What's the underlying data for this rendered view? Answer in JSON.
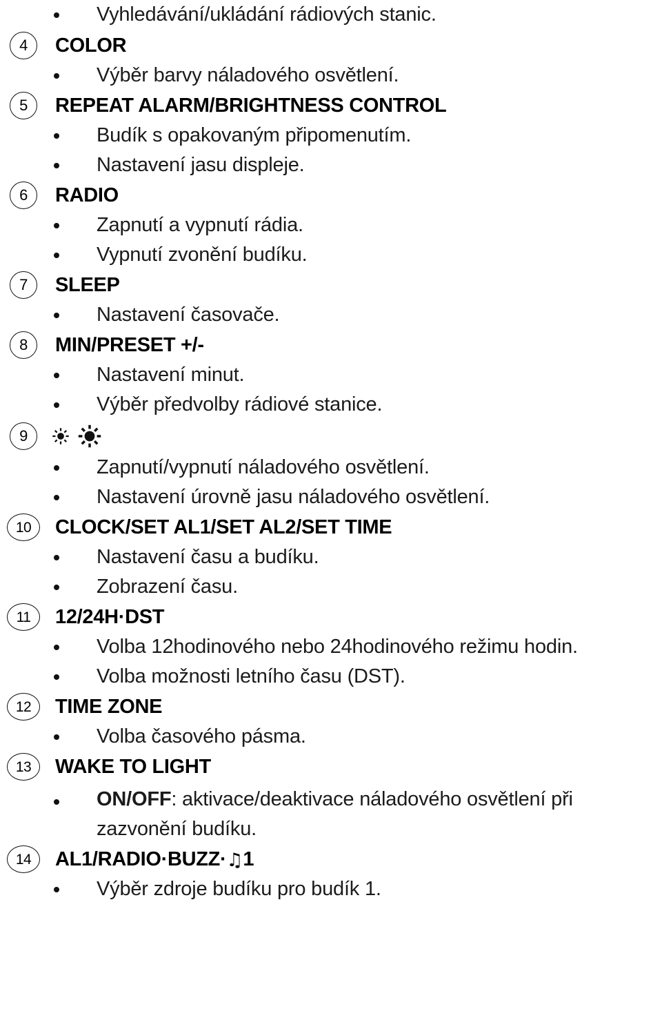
{
  "page": {
    "language": "cs",
    "text_color": "#111111"
  },
  "intro_bullet": "Vyhledávání/ukládání rádiových stanic.",
  "items": [
    {
      "number": "4",
      "heading": "COLOR",
      "bullets": [
        "Výběr barvy náladového osvětlení."
      ]
    },
    {
      "number": "5",
      "heading": "REPEAT ALARM/BRIGHTNESS CONTROL",
      "bullets": [
        "Budík s opakovaným připomenutím.",
        "Nastavení jasu displeje."
      ]
    },
    {
      "number": "6",
      "heading": "RADIO",
      "bullets": [
        "Zapnutí a vypnutí rádia.",
        "Vypnutí zvonění budíku."
      ]
    },
    {
      "number": "7",
      "heading": "SLEEP",
      "bullets": [
        "Nastavení časovače."
      ]
    },
    {
      "number": "8",
      "heading": "MIN/PRESET +/-",
      "bullets": [
        "Nastavení minut.",
        "Výběr předvolby rádiové stanice."
      ]
    },
    {
      "number": "9",
      "heading": "",
      "heading_icons": [
        "sun-dim-icon",
        "sun-bright-icon"
      ],
      "bullets": [
        "Zapnutí/vypnutí náladového osvětlení.",
        "Nastavení úrovně jasu náladového osvětlení."
      ]
    },
    {
      "number": "10",
      "heading": "CLOCK/SET AL1/SET AL2/SET TIME",
      "bullets": [
        "Nastavení času a budíku.",
        "Zobrazení času."
      ]
    },
    {
      "number": "11",
      "heading": "12/24H·DST",
      "bullets": [
        "Volba 12hodinového nebo 24hodinového režimu hodin.",
        "Volba možnosti letního času (DST)."
      ]
    },
    {
      "number": "12",
      "heading": "TIME ZONE",
      "bullets": [
        "Volba časového pásma."
      ]
    },
    {
      "number": "13",
      "heading": "WAKE TO LIGHT",
      "bullets": []
    },
    {
      "number": "14",
      "heading_parts": {
        "before": "AL1/RADIO·BUZZ·",
        "note_glyph": "♫",
        "after": "1"
      },
      "bullets": [
        "Výběr zdroje budíku pro budík 1."
      ]
    }
  ],
  "wake_to_light_bullet": {
    "bold": "ON/OFF",
    "rest": ": aktivace/deaktivace náladového osvětlení při",
    "line2": "zazvonění budíku."
  }
}
